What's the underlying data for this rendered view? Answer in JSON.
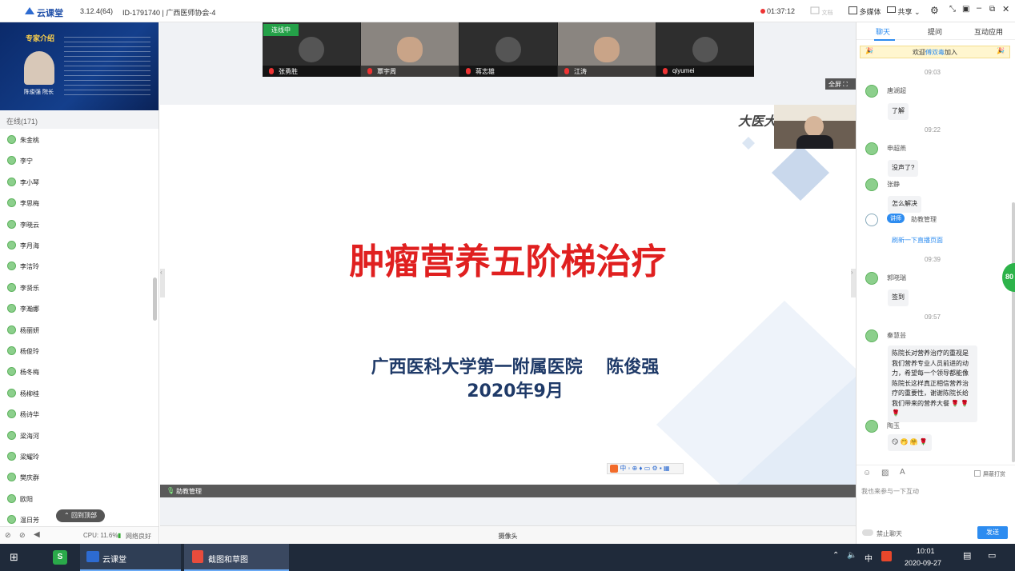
{
  "titlebar": {
    "app_name": "云课堂",
    "version": "3.12.4(64)",
    "room_id": "ID-1791740 | 广西医师协会-4",
    "timer": "01:37:12",
    "doc": "文档",
    "media": "多媒体",
    "share": "共享"
  },
  "left": {
    "promo_title": "专家介绍",
    "promo_name": "陈俊强 院长",
    "online_header": "在线(171)",
    "users": [
      "朱金桃",
      "李宁",
      "李小琴",
      "李思梅",
      "李晓云",
      "李月海",
      "李洁玲",
      "李贤乐",
      "李瀚娜",
      "杨丽妍",
      "杨俊玲",
      "杨冬梅",
      "杨柳桂",
      "杨诗华",
      "梁海河",
      "梁耀玲",
      "樊庆群",
      "欧阳",
      "温日芳"
    ],
    "back_to_top": "回到顶部",
    "cpu": "CPU: 11.6%",
    "network": "网络良好"
  },
  "video_strip": {
    "live_badge": "连线中",
    "participants": [
      "张勇胜",
      "覃宇周",
      "蒋志雄",
      "江涛",
      "qiyumei"
    ]
  },
  "main": {
    "fullscreen": "全屏",
    "slide_title": "肿瘤营养五阶梯治疗",
    "slide_subtitle": "广西医科大学第一附属医院　 陈俊强",
    "slide_date": "2020年9月",
    "slide_corner_text": "大医大",
    "assistant_bar": "助教管理",
    "camera_label": "摄像头"
  },
  "right": {
    "tabs": [
      "聊天",
      "提问",
      "互动应用"
    ],
    "welcome": {
      "prefix": "欢迎",
      "name": "傅双毒",
      "suffix": "加入"
    },
    "messages": [
      {
        "time": "09:03"
      },
      {
        "name": "唐湖超",
        "text": "了解"
      },
      {
        "time": "09:22"
      },
      {
        "name": "申超燕",
        "text": "没声了?"
      },
      {
        "name": "张静",
        "text": "怎么解决"
      },
      {
        "badge": "讲师",
        "name": "助教管理",
        "text": "刷新一下直播页面"
      },
      {
        "time": "09:39"
      },
      {
        "name": "郭晓瑞",
        "text": "签到"
      },
      {
        "time": "09:57"
      },
      {
        "name": "秦慧芸",
        "text": "陈院长对营养治疗的重视是我们营养专业人员前进的动力，希望每一个领导都能像陈院长这样真正相信营养治疗的重要性，谢谢陈院长给我们带来的营养大餐 🌹 🌹 🌹"
      },
      {
        "name": "陶玉",
        "text": "😏 🤭 🤗 🌹"
      }
    ],
    "screen_shield": "屏蔽打赏",
    "input_placeholder": "我也来参与一下互动",
    "ban_chat": "禁止聊天",
    "send": "发送",
    "side_badge": "80"
  },
  "taskbar": {
    "app1": "云课堂",
    "app2": "截图和草图",
    "ime": "中",
    "time": "10:01",
    "date": "2020-09-27"
  },
  "colors": {
    "accent": "#2d8cf0",
    "slide_red": "#e02020",
    "slide_navy": "#1f3a68",
    "online_green": "#8ccf8c"
  }
}
